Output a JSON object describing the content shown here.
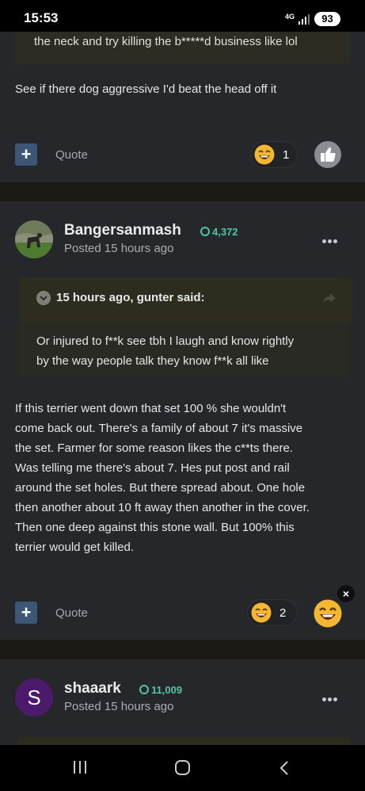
{
  "status_bar": {
    "time": "15:53",
    "network": "4G",
    "battery": "93"
  },
  "post1": {
    "quote_tail": "the neck and try killing the b*****d business like lol",
    "body": "See if there dog aggressive I'd beat the head off it",
    "quote_label": "Quote",
    "reaction_count": "1"
  },
  "post2": {
    "author": "Bangersanmash",
    "reputation": "4,372",
    "posted": "Posted 15 hours ago",
    "quote": {
      "header": "15 hours ago, gunter said:",
      "lines": [
        "Or injured to f**k  see tbh I laugh and know rightly",
        "by the way people talk they know f**k all like"
      ]
    },
    "body_lines": [
      "If this terrier went down that set 100 % she wouldn't",
      "come back out. There's a family of about 7 it's massive",
      "the set. Farmer for some reason likes the c**ts there.",
      "Was telling me there's about 7. Hes put post and rail",
      "around the set holes. But there spread about. One hole",
      "then another about 10 ft away then another in the cover.",
      "Then one deep against this stone wall. But 100% this",
      "terrier would get killed."
    ],
    "quote_label": "Quote",
    "reaction_count": "2",
    "close_symbol": "×"
  },
  "post3": {
    "avatar_letter": "S",
    "author": "shaaark",
    "reputation": "11,009",
    "posted": "Posted 15 hours ago"
  },
  "icons": {
    "plus": "+",
    "reaction": "laughing-emoji-icon",
    "like": "thumbs-up-icon",
    "more": "more-dots-icon",
    "share": "share-arrow-icon",
    "nav": [
      "recent-apps-icon",
      "home-icon",
      "back-icon"
    ]
  },
  "colors": {
    "background": "#26272b",
    "separator": "#1b1a14",
    "quote_bg": "#2e2c1f",
    "reputation_green": "#4fc79e",
    "plus_button": "#3c5676"
  }
}
